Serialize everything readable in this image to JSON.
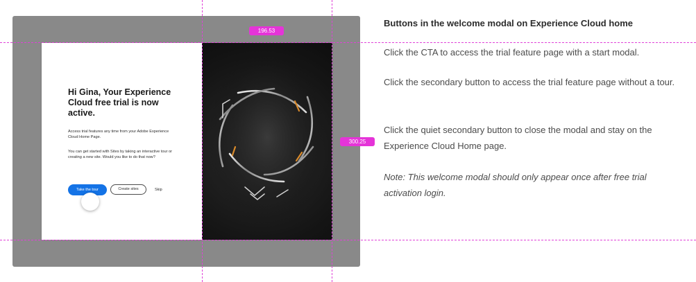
{
  "mockup": {
    "title": "Hi Gina, Your Experience Cloud free trial is now active.",
    "body_paragraph_1": "Access trial features any time from your Adobe Experience Cloud Home Page.",
    "body_paragraph_2": "You can get started with Sites by taking an interactive tour or creating a new site. Would you like to do that now?",
    "buttons": {
      "primary_label": "Take the tour",
      "secondary_label": "Create sites",
      "quiet_label": "Skip"
    },
    "colors": {
      "primary_button": "#1473e6",
      "backdrop": "#898989",
      "hero_background": "#151515"
    }
  },
  "measurements": {
    "width_label": "196.53",
    "height_label": "300.25",
    "guide_color": "#e534d8"
  },
  "annotations": {
    "heading": "Buttons in the welcome modal on Experience Cloud home",
    "paragraphs": [
      "Click the CTA to access the trial feature page with a start modal.",
      "Click the secondary button to access the trial feature page without a tour.",
      "Click the quiet secondary button to close the modal and stay on the Experience Cloud Home page.",
      "Note: This welcome modal should only appear once after free trial activation login."
    ]
  }
}
